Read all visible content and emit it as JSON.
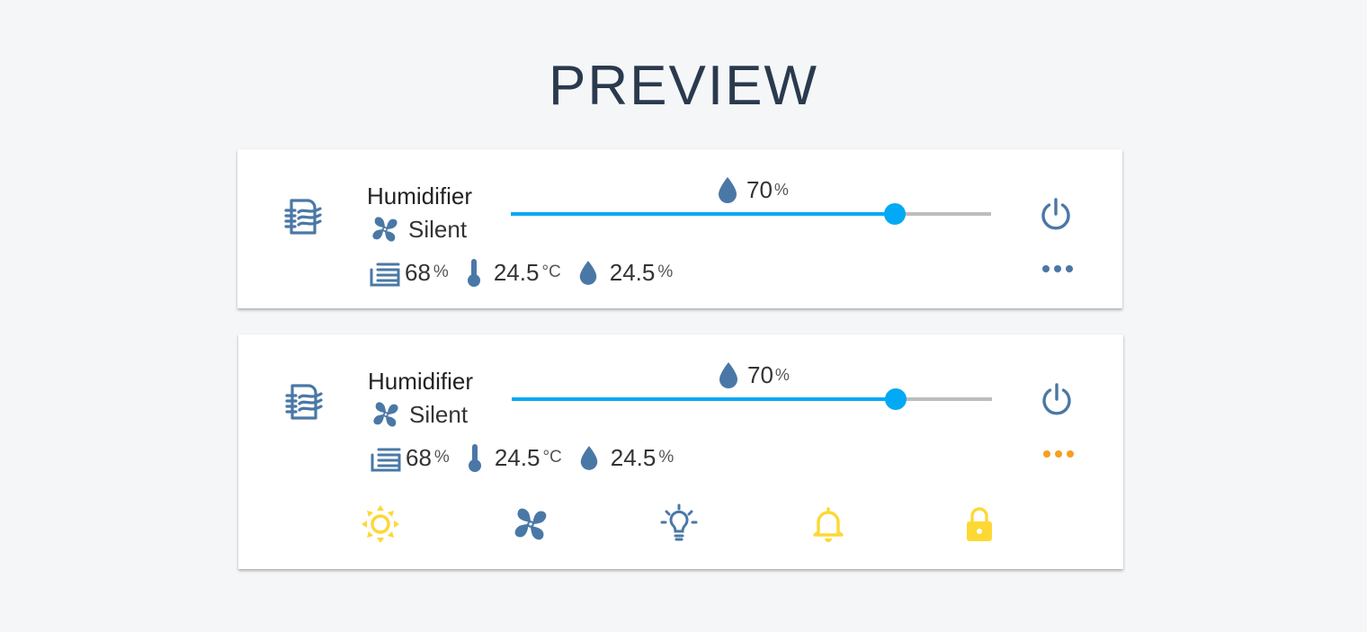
{
  "page": {
    "title": "PREVIEW"
  },
  "colors": {
    "icon": "#4a78a6",
    "slider": "#03a9f4",
    "track": "#bdbdbd",
    "more_active": "#f5a020",
    "feature_on": "#fdd835"
  },
  "cards": [
    {
      "name": "Humidifier",
      "mode": "Silent",
      "target": {
        "value": "70",
        "unit": "%",
        "fraction": 0.8
      },
      "stats": {
        "water": {
          "value": "68",
          "unit": "%"
        },
        "temperature": {
          "value": "24.5",
          "unit": "°C"
        },
        "humidity": {
          "value": "24.5",
          "unit": "%"
        }
      },
      "icons": [
        "humidifier-icon",
        "fan-icon",
        "water-drop-icon",
        "power-icon",
        "more-icon",
        "water-level-icon",
        "thermometer-icon"
      ]
    },
    {
      "name": "Humidifier",
      "mode": "Silent",
      "target": {
        "value": "70",
        "unit": "%",
        "fraction": 0.8
      },
      "stats": {
        "water": {
          "value": "68",
          "unit": "%"
        },
        "temperature": {
          "value": "24.5",
          "unit": "°C"
        },
        "humidity": {
          "value": "24.5",
          "unit": "%"
        }
      },
      "features": [
        {
          "icon": "brightness-icon",
          "color": "#fdd835"
        },
        {
          "icon": "fan-icon",
          "color": "#4a78a6"
        },
        {
          "icon": "lightbulb-icon",
          "color": "#4a78a6"
        },
        {
          "icon": "bell-icon",
          "color": "#fdd835"
        },
        {
          "icon": "lock-icon",
          "color": "#fdd835"
        }
      ]
    }
  ]
}
